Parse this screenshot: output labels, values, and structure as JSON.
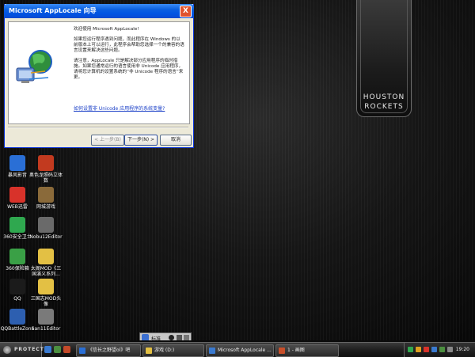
{
  "window": {
    "title": "Microsoft AppLocale 向导",
    "close": "X",
    "welcome": "欢迎使用 Microsoft AppLocale!",
    "para1": "如果您运行程序遇到问题，而此程序在 Windows 的以前版本上可以运行，此程序会帮助您选择一个的兼容的语言设置来解决这些问题。",
    "para2": "请注意，AppLocale 只是解决部分应用程序的临时措施。如果您通常运行的语言使用非 Unicode 应用程序，请将您计算机的设置系统的“非 Unicode 程序的语言”来更。",
    "link": "如何设置非 Unicode 应用程序的系统变量?",
    "back_label": "< 上一步(B)",
    "next_label": "下一步(N) >",
    "cancel_label": "取消"
  },
  "wallpaper": {
    "logo_line1": "HOUSTON",
    "logo_line2": "ROCKETS"
  },
  "desktop_icons": [
    {
      "label": "暴风影音",
      "icon": "media-player-icon",
      "color": "#2a6fd6"
    },
    {
      "label": "奥色龙照码立体数",
      "icon": "dragon-icon",
      "color": "#c23a1f"
    },
    {
      "label": "WEB迅雷",
      "icon": "thunder-icon",
      "color": "#d8322a"
    },
    {
      "label": "网城游戏",
      "icon": "game-icon",
      "color": "#8a6a3a"
    },
    {
      "label": "360安全卫士",
      "icon": "shield-icon",
      "color": "#2fa84f"
    },
    {
      "label": "Nobu12Editor",
      "icon": "editor-icon",
      "color": "#6a6a6a"
    },
    {
      "label": "360保险箱",
      "icon": "safe-icon",
      "color": "#3aa046"
    },
    {
      "label": "太阁MOD《三国演义系列...",
      "icon": "folder-icon",
      "color": "#e3c044"
    },
    {
      "label": "QQ",
      "icon": "qq-penguin-icon",
      "color": "#1b1b1b"
    },
    {
      "label": "三国志MOD头像",
      "icon": "folder-icon",
      "color": "#e3c044"
    },
    {
      "label": "QQBattleZone",
      "icon": "qq-battle-icon",
      "color": "#2d5fb0"
    },
    {
      "label": "San11Editor",
      "icon": "editor-icon",
      "color": "#7a7a7a"
    }
  ],
  "ime_bar": {
    "label": "标准"
  },
  "taskbar": {
    "start_label": "PROTECT",
    "tasks": [
      {
        "label": "《信长之野望ol》吧",
        "color": "#2a6fd6"
      },
      {
        "label": "游戏 (D:)",
        "color": "#e3c044"
      },
      {
        "label": "Microsoft AppLocale ...",
        "color": "#3a7ad0"
      },
      {
        "label": "1 - 画图",
        "color": "#c84f2a"
      }
    ],
    "clock": "19:20"
  }
}
